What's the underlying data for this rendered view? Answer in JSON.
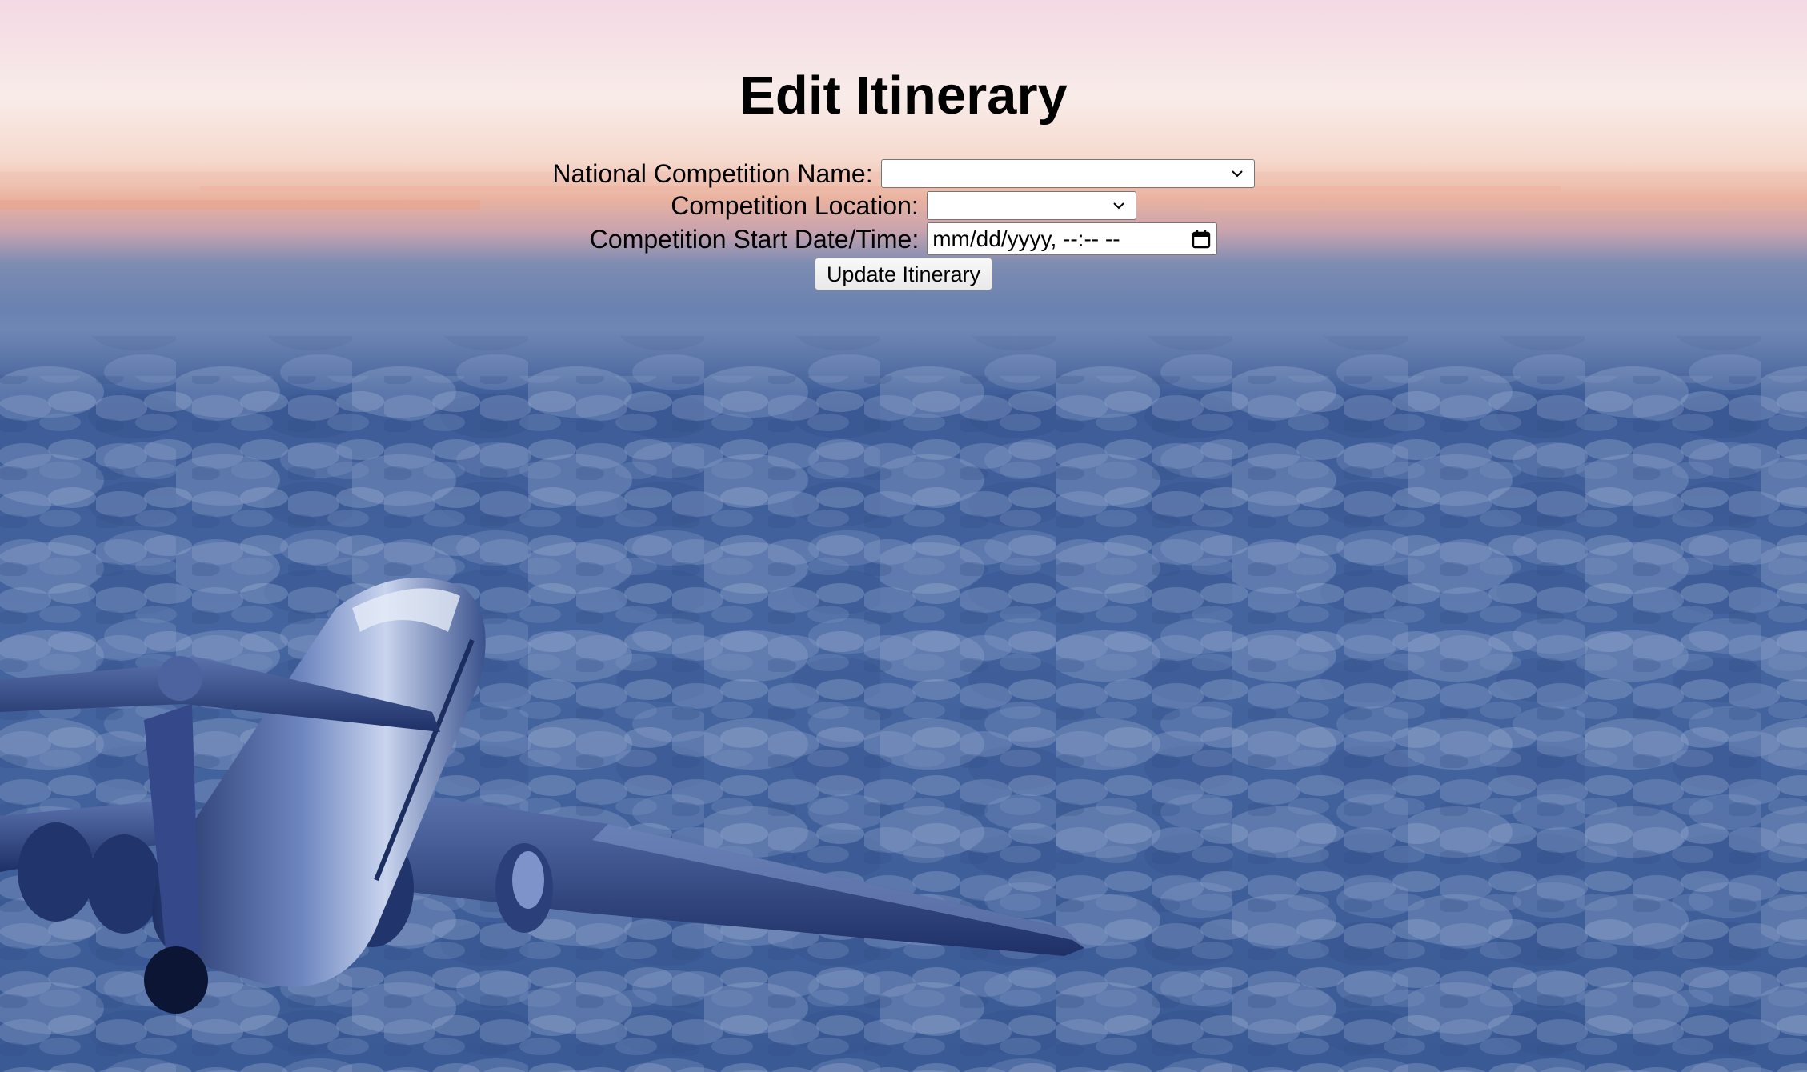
{
  "page": {
    "title": "Edit Itinerary"
  },
  "form": {
    "competition_name_label": "National Competition Name:",
    "competition_name_value": "",
    "competition_location_label": "Competition Location:",
    "competition_location_value": "",
    "start_datetime_label": "Competition Start Date/Time:",
    "start_datetime_placeholder": "mm/dd/yyyy, --:-- --",
    "submit_label": "Update Itinerary"
  },
  "icons": {
    "dropdown": "chevron-down-icon",
    "date_picker": "calendar-icon"
  },
  "colors": {
    "sky_top": "#f6dfe6",
    "sky_glow": "#f2b79d",
    "cloud_blue": "#3b5b95",
    "text": "#000000"
  }
}
